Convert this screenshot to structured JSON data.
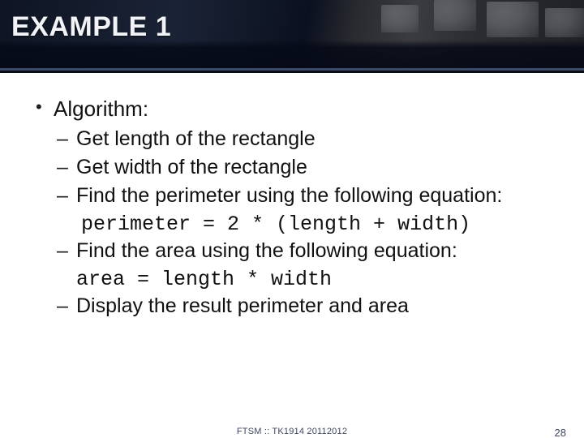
{
  "title": "EXAMPLE 1",
  "bullet_main": "Algorithm:",
  "steps": {
    "s1": "Get length of the rectangle",
    "s2": "Get width of the rectangle",
    "s3": "Find the perimeter using the following equation:",
    "s3_code": "perimeter = 2 * (length + width)",
    "s4": "Find the area using the following equation:",
    "s4_code": "area = length * width",
    "s5": "Display the result perimeter and area"
  },
  "footer": {
    "center": "FTSM :: TK1914 20112012",
    "page": "28"
  }
}
